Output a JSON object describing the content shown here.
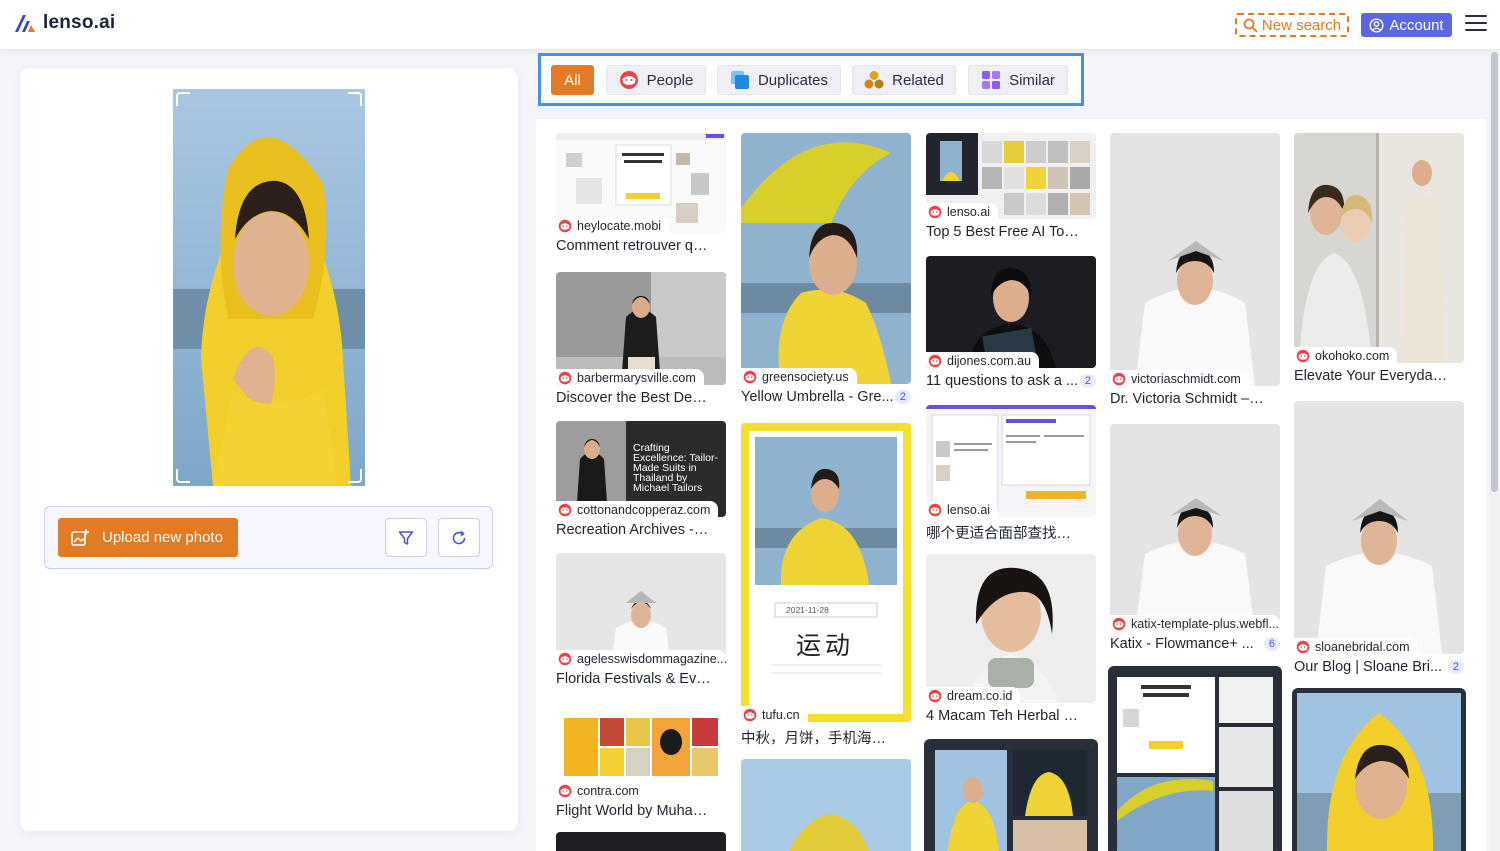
{
  "header": {
    "logo_text": "lenso.ai",
    "new_search": "New search",
    "account": "Account"
  },
  "upload": {
    "label": "Upload new photo"
  },
  "tabs": [
    {
      "label": "All",
      "icon": "all",
      "active": true
    },
    {
      "label": "People",
      "icon": "people-face-icon",
      "active": false
    },
    {
      "label": "Duplicates",
      "icon": "duplicates-icon",
      "active": false
    },
    {
      "label": "Related",
      "icon": "related-icon",
      "active": false
    },
    {
      "label": "Similar",
      "icon": "similar-icon",
      "active": false
    }
  ],
  "results": [
    {
      "source": "heylocate.mobi",
      "title": "Comment retrouver que..."
    },
    {
      "source": "barbermarysville.com",
      "title": "Discover the Best Deals ..."
    },
    {
      "source": "cottonandcopperaz.com",
      "title": "Recreation Archives - Co...",
      "overlay": "Crafting Excellence: Tailor-Made Suits in Thailand by Michael Tailors"
    },
    {
      "source": "agelesswisdommagazine....",
      "title": "Florida Festivals & Event..."
    },
    {
      "source": "contra.com",
      "title": "Flight World by Muham..."
    },
    {
      "source": "greensociety.us",
      "title": "Yellow Umbrella - Gre...",
      "count": "2"
    },
    {
      "source": "tufu.cn",
      "title": "中秋，月饼，手机海报,手...",
      "poster_date": "2021-11-28",
      "poster_big": "运动"
    },
    {
      "source": "lenso.ai",
      "title": "Top 5 Best Free AI Tools ..."
    },
    {
      "source": "dijones.com.au",
      "title": "11 questions to ask a ...",
      "count": "2"
    },
    {
      "source": "lenso.ai",
      "title": "哪个更适合面部查找：len..."
    },
    {
      "source": "dream.co.id",
      "title": "4 Macam Teh Herbal yan..."
    },
    {
      "source": "victoriaschmidt.com",
      "title": "Dr. Victoria Schmidt – Th..."
    },
    {
      "source": "katix-template-plus.webfl...",
      "title": "Katix - Flowmance+ ...",
      "count": "6"
    },
    {
      "source": "okohoko.com",
      "title": "Elevate Your Everyday wi..."
    },
    {
      "source": "sloanebridal.com",
      "title": "Our Blog | Sloane Bri...",
      "count": "2"
    }
  ]
}
